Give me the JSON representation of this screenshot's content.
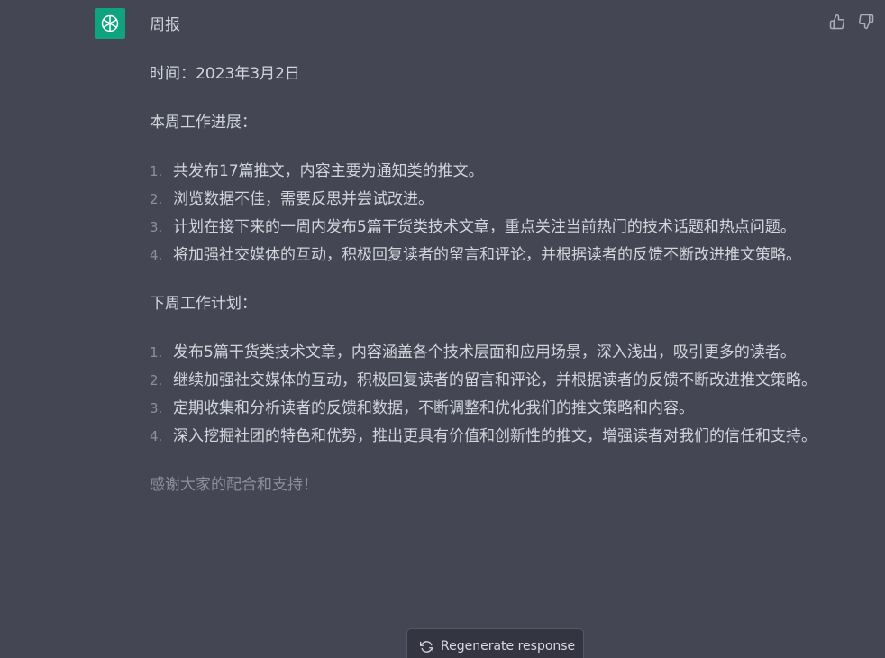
{
  "message": {
    "title": "周报",
    "date_line": "时间：2023年3月2日",
    "this_week": {
      "heading": "本周工作进展：",
      "items": [
        {
          "num": "1.",
          "text": "共发布17篇推文，内容主要为通知类的推文。"
        },
        {
          "num": "2.",
          "text": "浏览数据不佳，需要反思并尝试改进。"
        },
        {
          "num": "3.",
          "text": "计划在接下来的一周内发布5篇干货类技术文章，重点关注当前热门的技术话题和热点问题。"
        },
        {
          "num": "4.",
          "text": "将加强社交媒体的互动，积极回复读者的留言和评论，并根据读者的反馈不断改进推文策略。"
        }
      ]
    },
    "next_week": {
      "heading": "下周工作计划：",
      "items": [
        {
          "num": "1.",
          "text": "发布5篇干货类技术文章，内容涵盖各个技术层面和应用场景，深入浅出，吸引更多的读者。"
        },
        {
          "num": "2.",
          "text": "继续加强社交媒体的互动，积极回复读者的留言和评论，并根据读者的反馈不断改进推文策略。"
        },
        {
          "num": "3.",
          "text": "定期收集和分析读者的反馈和数据，不断调整和优化我们的推文策略和内容。"
        },
        {
          "num": "4.",
          "text": "深入挖掘社团的特色和优势，推出更具有价值和创新性的推文，增强读者对我们的信任和支持。"
        }
      ]
    },
    "closing": "感谢大家的配合和支持！"
  },
  "regenerate_button": {
    "label": "Regenerate response"
  },
  "icons": {
    "avatar": "openai-logo-icon",
    "thumbs_up": "thumbs-up-icon",
    "thumbs_down": "thumbs-down-icon",
    "regenerate": "refresh-icon"
  },
  "colors": {
    "background": "#444654",
    "avatar_bg": "#10a37f",
    "text": "#d1d5db"
  }
}
